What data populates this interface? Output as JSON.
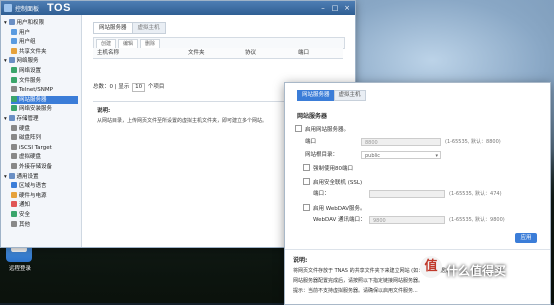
{
  "app": {
    "logo_text": "TOS",
    "window_title": "控制面板"
  },
  "sidebar": {
    "items": [
      {
        "label": "用户和权限",
        "level": 0,
        "color": "#6a8fc4"
      },
      {
        "label": "用户",
        "level": 1,
        "color": "#5a9be0"
      },
      {
        "label": "用户组",
        "level": 1,
        "color": "#5a9be0"
      },
      {
        "label": "共享文件夹",
        "level": 1,
        "color": "#e6a23c"
      },
      {
        "label": "网络服务",
        "level": 0,
        "color": "#6a8fc4"
      },
      {
        "label": "网络设置",
        "level": 1,
        "color": "#3aa56b"
      },
      {
        "label": "文件服务",
        "level": 1,
        "color": "#3aa56b"
      },
      {
        "label": "Telnet/SNMP",
        "level": 1,
        "color": "#888888"
      },
      {
        "label": "网站服务器",
        "level": 1,
        "color": "#3aa56b",
        "selected": true
      },
      {
        "label": "网络安装服务",
        "level": 1,
        "color": "#3aa56b"
      },
      {
        "label": "存储管理",
        "level": 0,
        "color": "#6a8fc4"
      },
      {
        "label": "硬盘",
        "level": 1,
        "color": "#888888"
      },
      {
        "label": "磁盘阵列",
        "level": 1,
        "color": "#888888"
      },
      {
        "label": "iSCSI Target",
        "level": 1,
        "color": "#888888"
      },
      {
        "label": "虚拟硬盘",
        "level": 1,
        "color": "#888888"
      },
      {
        "label": "外接存储设备",
        "level": 1,
        "color": "#888888"
      },
      {
        "label": "通用设置",
        "level": 0,
        "color": "#6a8fc4"
      },
      {
        "label": "区域与语言",
        "level": 1,
        "color": "#3b7dd8"
      },
      {
        "label": "硬件与电源",
        "level": 1,
        "color": "#e6a23c"
      },
      {
        "label": "通知",
        "level": 1,
        "color": "#e05555"
      },
      {
        "label": "安全",
        "level": 1,
        "color": "#3aa56b"
      },
      {
        "label": "其他",
        "level": 1,
        "color": "#888888"
      }
    ]
  },
  "cp_main": {
    "tabs": [
      "网站服务器",
      "虚拟主机"
    ],
    "toolbar": [
      "创建",
      "编辑",
      "删除"
    ],
    "columns": [
      "主机名称",
      "文件夹",
      "协议",
      "端口"
    ],
    "pager_text_a": "总数：0 | 显示",
    "pager_count": "10",
    "pager_text_b": "个项目",
    "page_number": "1",
    "desc_title": "说明:",
    "desc_text": "从网站目录，上传网页文件至所设置的虚拟主机文件夹，即可建立多个网站。"
  },
  "dialog": {
    "tabs": [
      "网站服务器",
      "虚拟主机"
    ],
    "section_title": "网站服务器",
    "enable_label": "启用网站服务器。",
    "port_label": "端口",
    "port_value": "8800",
    "port_hint": "(1-65535, 默认：8800)",
    "root_label": "网站根目录：",
    "root_value": "public",
    "php_label": "强制使用80端口",
    "https_label": "启用安全联机 (SSL)",
    "https_port_label": "端口：",
    "https_port_hint": "(1-65535, 默认：474)",
    "webdav_label": "启用 WebDAV服务。",
    "webdav_port_label": "WebDAV 通讯端口：",
    "webdav_port_value": "9800",
    "webdav_port_hint": "(1-65535, 默认：9800)",
    "apply_label": "应用",
    "desc_title": "说明:",
    "desc_lines": [
      "将网页文件存放于 TNAS 的共享文件夹下来建立网站 (如：web 数据)。",
      "网站服务器配置完成后，请按照以下指定链接网站服务器。",
      "提示：当前不支持虚拟服务器。请确保以启用文件服务..."
    ]
  },
  "desktop": {
    "icon_label": "远程登录"
  },
  "watermark": {
    "circle_char": "值",
    "text": "什么值得买"
  }
}
